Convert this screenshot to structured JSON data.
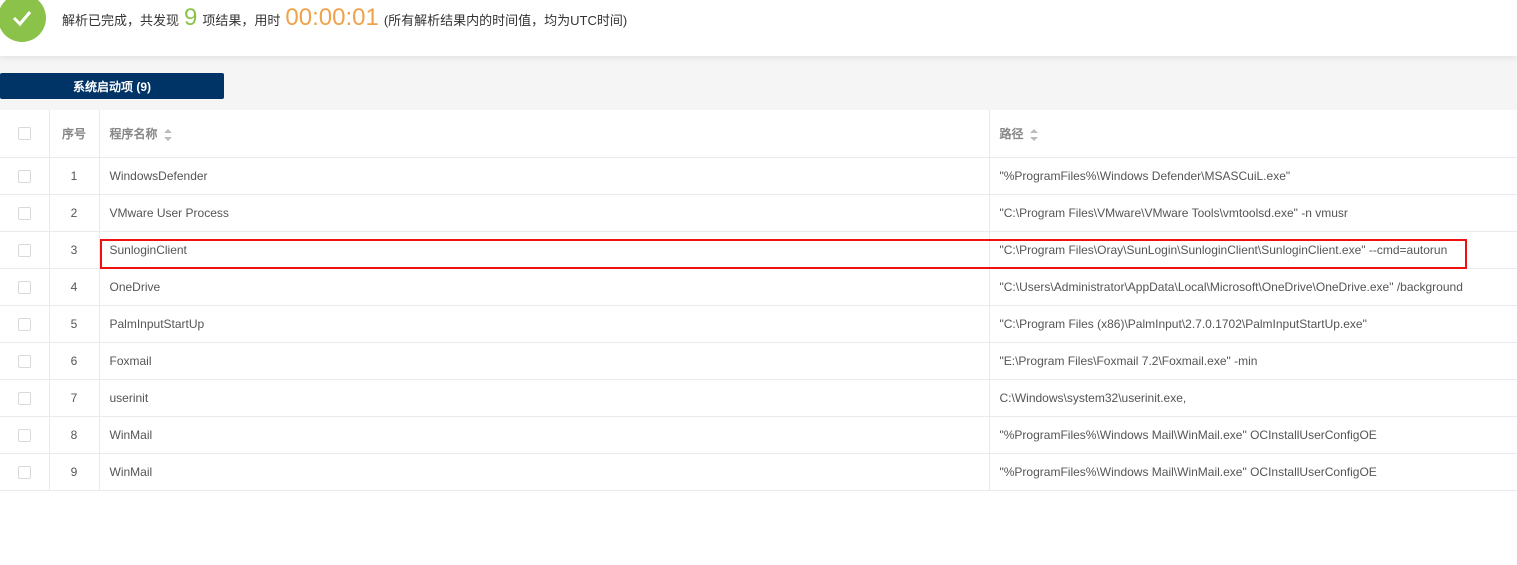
{
  "status": {
    "prefix": "解析已完成，共发现",
    "count": "9",
    "mid": "项结果，用时",
    "elapsed": "00:00:01",
    "note": "(所有解析结果内的时间值，均为UTC时间)",
    "icon": "check-icon"
  },
  "tab": {
    "label": "系统启动项 (9)"
  },
  "table": {
    "headers": {
      "index": "序号",
      "name": "程序名称",
      "path": "路径"
    },
    "rows": [
      {
        "index": "1",
        "name": "WindowsDefender",
        "path": "\"%ProgramFiles%\\Windows Defender\\MSASCuiL.exe\""
      },
      {
        "index": "2",
        "name": "VMware User Process",
        "path": "\"C:\\Program Files\\VMware\\VMware Tools\\vmtoolsd.exe\" -n vmusr"
      },
      {
        "index": "3",
        "name": "SunloginClient",
        "path": "\"C:\\Program Files\\Oray\\SunLogin\\SunloginClient\\SunloginClient.exe\" --cmd=autorun"
      },
      {
        "index": "4",
        "name": "OneDrive",
        "path": "\"C:\\Users\\Administrator\\AppData\\Local\\Microsoft\\OneDrive\\OneDrive.exe\" /background"
      },
      {
        "index": "5",
        "name": "PalmInputStartUp",
        "path": "\"C:\\Program Files (x86)\\PalmInput\\2.7.0.1702\\PalmInputStartUp.exe\""
      },
      {
        "index": "6",
        "name": "Foxmail",
        "path": "\"E:\\Program Files\\Foxmail 7.2\\Foxmail.exe\" -min"
      },
      {
        "index": "7",
        "name": "userinit",
        "path": "C:\\Windows\\system32\\userinit.exe,"
      },
      {
        "index": "8",
        "name": "WinMail",
        "path": "\"%ProgramFiles%\\Windows Mail\\WinMail.exe\" OCInstallUserConfigOE"
      },
      {
        "index": "9",
        "name": "WinMail",
        "path": "\"%ProgramFiles%\\Windows Mail\\WinMail.exe\" OCInstallUserConfigOE"
      }
    ]
  },
  "colors": {
    "success": "#8bc34a",
    "time": "#f0a24a",
    "tab": "#003366",
    "highlight": "#e11111"
  }
}
